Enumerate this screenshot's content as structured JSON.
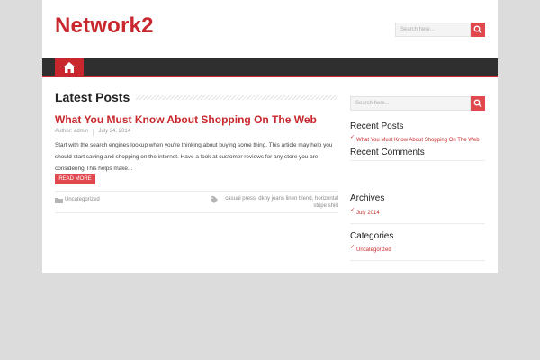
{
  "site": {
    "title": "Network2"
  },
  "header_search": {
    "placeholder": "Search here..."
  },
  "nav": {
    "home_icon": "home-icon"
  },
  "main": {
    "section_title": "Latest Posts",
    "post": {
      "title": "What You Must Know About Shopping On The Web",
      "author_label": "Author: admin",
      "date": "July 24, 2014",
      "excerpt": "Start with the search engines lookup when you're thinking about buying some thing. This article may help you should start saving and shopping on the internet. Have a look at customer reviews for any store you are considering.This helps make...",
      "read_more": "READ MORE",
      "category": "Uncategorized",
      "tags": "casual press, dkny jeans linen blend, horizontal stripe shirt"
    }
  },
  "sidebar": {
    "search_placeholder": "Search here...",
    "recent_posts": {
      "title": "Recent Posts",
      "items": [
        {
          "label": "What You Must Know About Shopping On The Web"
        }
      ]
    },
    "recent_comments": {
      "title": "Recent Comments"
    },
    "archives": {
      "title": "Archives",
      "items": [
        {
          "label": "July 2014"
        }
      ]
    },
    "categories": {
      "title": "Categories",
      "items": [
        {
          "label": "Uncategorized"
        }
      ]
    }
  },
  "colors": {
    "accent": "#c8282d",
    "button": "#e0484e",
    "nav_bg": "#2f2f2f",
    "page_bg": "#dcdcdc"
  }
}
